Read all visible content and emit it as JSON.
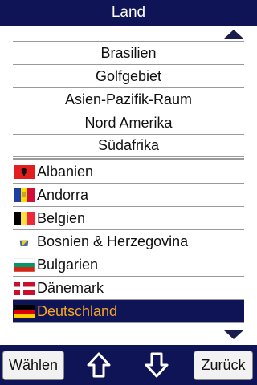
{
  "title": "Land",
  "regions": [
    "Brasilien",
    "Golfgebiet",
    "Asien-Pazifik-Raum",
    "Nord Amerika",
    "Südafrika"
  ],
  "countries": [
    {
      "name": "Albanien",
      "flag": "albania-flag-icon"
    },
    {
      "name": "Andorra",
      "flag": "andorra-flag-icon"
    },
    {
      "name": "Belgien",
      "flag": "belgium-flag-icon"
    },
    {
      "name": "Bosnien & Herzegovina",
      "flag": "bosnia-flag-icon"
    },
    {
      "name": "Bulgarien",
      "flag": "bulgaria-flag-icon"
    },
    {
      "name": "Dänemark",
      "flag": "denmark-flag-icon"
    },
    {
      "name": "Deutschland",
      "flag": "germany-flag-icon",
      "selected": true
    }
  ],
  "buttons": {
    "choose": "Wählen",
    "back": "Zurück"
  },
  "colors": {
    "bar": "#0f1457",
    "selected_text": "#f5a623"
  }
}
